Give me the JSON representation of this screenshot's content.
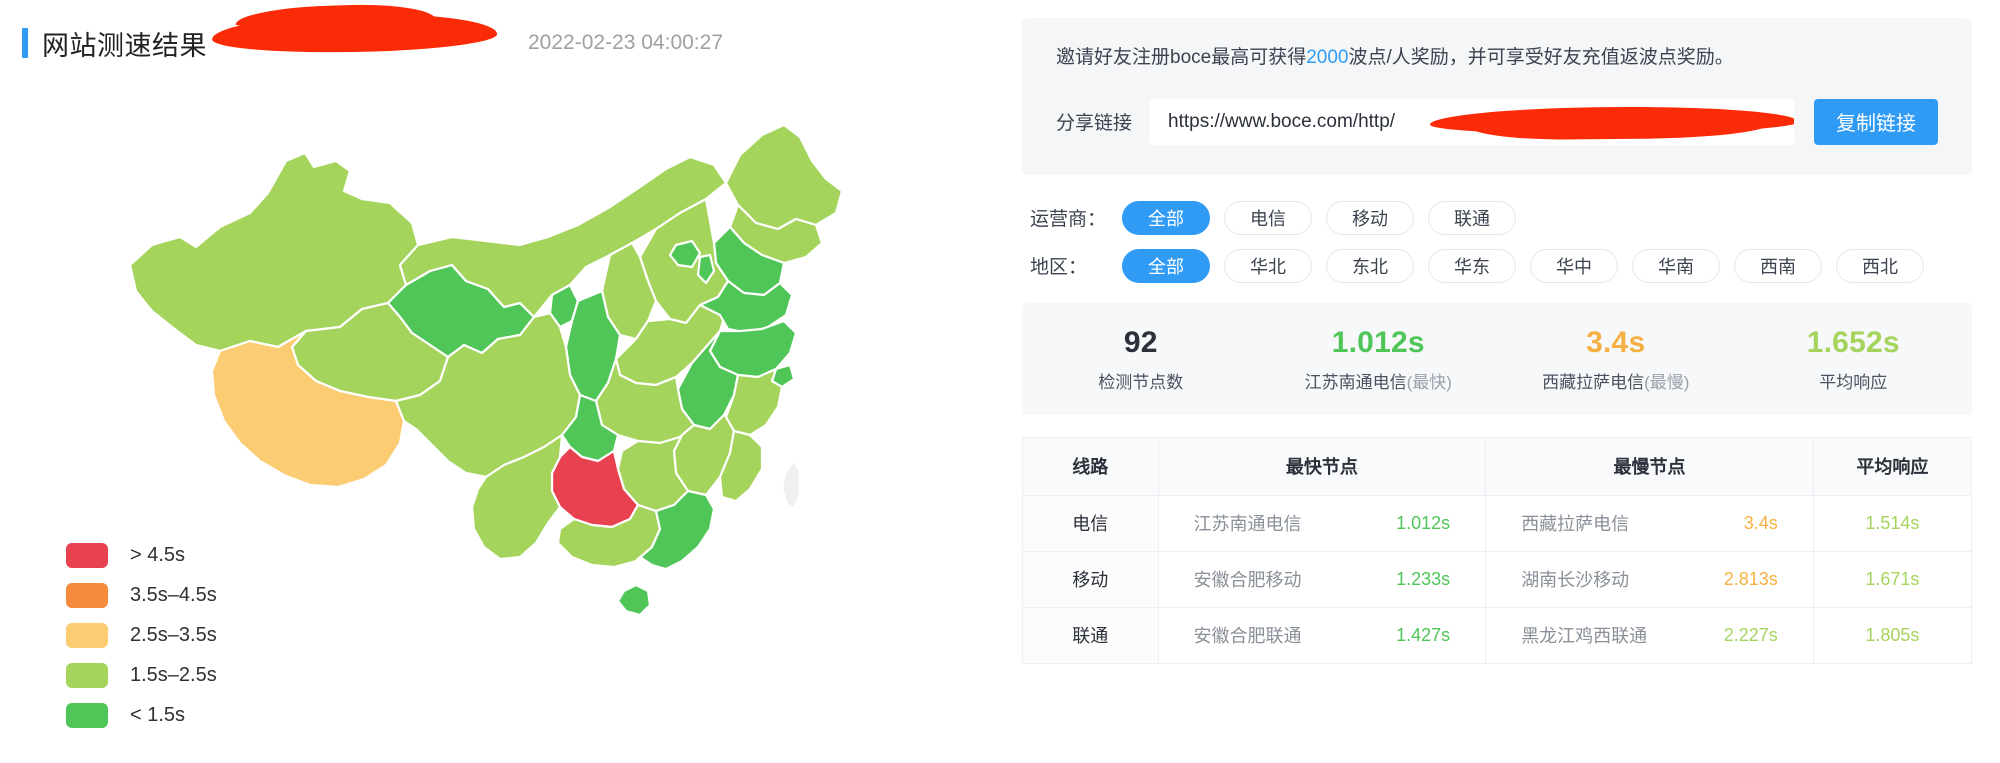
{
  "header": {
    "title": "网站测速结果",
    "timestamp": "2022-02-23 04:00:27",
    "accent_color": "#2f9bf5",
    "redaction_color": "#fc2b07"
  },
  "legend": {
    "items": [
      {
        "label": "> 4.5s",
        "color": "#e8414f"
      },
      {
        "label": "3.5s–4.5s",
        "color": "#f78b3c"
      },
      {
        "label": "2.5s–3.5s",
        "color": "#fbcc72"
      },
      {
        "label": "1.5s–2.5s",
        "color": "#a5d45c"
      },
      {
        "label": "< 1.5s",
        "color": "#4fc657"
      }
    ]
  },
  "map": {
    "name": "china-choropleth-map",
    "border_color": "#ffffff",
    "regions": [
      {
        "name": "新疆",
        "color": "#a5d45c"
      },
      {
        "name": "内蒙古",
        "color": "#a5d45c"
      },
      {
        "name": "黑龙江",
        "color": "#a5d45c"
      },
      {
        "name": "吉林",
        "color": "#a5d45c"
      },
      {
        "name": "辽宁",
        "color": "#4fc657"
      },
      {
        "name": "甘肃",
        "color": "#4fc657"
      },
      {
        "name": "青海",
        "color": "#a5d45c"
      },
      {
        "name": "西藏",
        "color": "#fbcc72"
      },
      {
        "name": "宁夏",
        "color": "#4fc657"
      },
      {
        "name": "陕西",
        "color": "#4fc657"
      },
      {
        "name": "山西",
        "color": "#a5d45c"
      },
      {
        "name": "河北",
        "color": "#a5d45c"
      },
      {
        "name": "北京",
        "color": "#4fc657"
      },
      {
        "name": "天津",
        "color": "#4fc657"
      },
      {
        "name": "山东",
        "color": "#4fc657"
      },
      {
        "name": "河南",
        "color": "#a5d45c"
      },
      {
        "name": "江苏",
        "color": "#4fc657"
      },
      {
        "name": "安徽",
        "color": "#4fc657"
      },
      {
        "name": "上海",
        "color": "#4fc657"
      },
      {
        "name": "湖北",
        "color": "#a5d45c"
      },
      {
        "name": "四川",
        "color": "#a5d45c"
      },
      {
        "name": "重庆",
        "color": "#4fc657"
      },
      {
        "name": "贵州",
        "color": "#e8414f"
      },
      {
        "name": "云南",
        "color": "#a5d45c"
      },
      {
        "name": "湖南",
        "color": "#a5d45c"
      },
      {
        "name": "江西",
        "color": "#a5d45c"
      },
      {
        "name": "浙江",
        "color": "#a5d45c"
      },
      {
        "name": "福建",
        "color": "#a5d45c"
      },
      {
        "name": "广东",
        "color": "#4fc657"
      },
      {
        "name": "广西",
        "color": "#a5d45c"
      },
      {
        "name": "海南",
        "color": "#4fc657"
      },
      {
        "name": "台湾",
        "color": "#f0f0f0"
      }
    ]
  },
  "invite": {
    "text_before": "邀请好友注册boce最高可获得",
    "highlight": "2000",
    "text_after": "波点/人奖励，并可享受好友充值返波点奖励。",
    "share_label": "分享链接",
    "share_url": "https://www.boce.com/http/",
    "share_placeholder": "https://www.boce.com/http/",
    "copy_label": "复制链接",
    "copy_color": "#2f9bf5"
  },
  "filters": {
    "isp": {
      "label": "运营商：",
      "options": [
        "全部",
        "电信",
        "移动",
        "联通"
      ],
      "selected": "全部"
    },
    "region": {
      "label": "地区：",
      "options": [
        "全部",
        "华北",
        "东北",
        "华东",
        "华中",
        "华南",
        "西南",
        "西北"
      ],
      "selected": "全部"
    }
  },
  "stats": [
    {
      "value": "92",
      "label": "检测节点数",
      "sub": "",
      "color": "#2b303a"
    },
    {
      "value": "1.012s",
      "label": "江苏南通电信",
      "sub": "(最快)",
      "color": "#4fc657"
    },
    {
      "value": "3.4s",
      "label": "西藏拉萨电信",
      "sub": "(最慢)",
      "color": "#f5b041"
    },
    {
      "value": "1.652s",
      "label": "平均响应",
      "sub": "",
      "color": "#a5d45c"
    }
  ],
  "table": {
    "columns": [
      "线路",
      "最快节点",
      "最慢节点",
      "平均响应"
    ],
    "rows": [
      {
        "route": "电信",
        "fast_node": "江苏南通电信",
        "fast_time": "1.012s",
        "fast_color": "#4fc657",
        "slow_node": "西藏拉萨电信",
        "slow_time": "3.4s",
        "slow_color": "#f5b041",
        "avg": "1.514s",
        "avg_color": "#a5d45c"
      },
      {
        "route": "移动",
        "fast_node": "安徽合肥移动",
        "fast_time": "1.233s",
        "fast_color": "#4fc657",
        "slow_node": "湖南长沙移动",
        "slow_time": "2.813s",
        "slow_color": "#f5b041",
        "avg": "1.671s",
        "avg_color": "#a5d45c"
      },
      {
        "route": "联通",
        "fast_node": "安徽合肥联通",
        "fast_time": "1.427s",
        "fast_color": "#4fc657",
        "slow_node": "黑龙江鸡西联通",
        "slow_time": "2.227s",
        "slow_color": "#a5d45c",
        "avg": "1.805s",
        "avg_color": "#a5d45c"
      }
    ]
  }
}
